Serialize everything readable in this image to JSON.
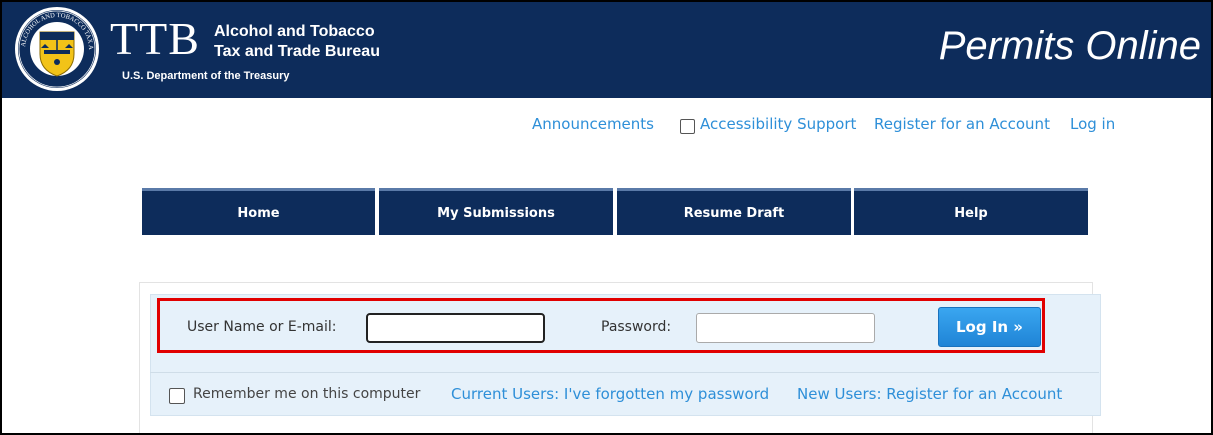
{
  "header": {
    "logo_text": "TTB",
    "agency_line1": "Alcohol and Tobacco",
    "agency_line2": "Tax and Trade Bureau",
    "department": "U.S. Department of the Treasury",
    "app_title": "Permits Online",
    "seal_text": "ALCOHOL AND TOBACCO TAX AND TRADE BUREAU"
  },
  "toplinks": {
    "announcements": "Announcements",
    "accessibility": "Accessibility Support",
    "register": "Register for an Account",
    "login": "Log in"
  },
  "nav": [
    "Home",
    "My Submissions",
    "Resume Draft",
    "Help"
  ],
  "login": {
    "username_label": "User Name or E-mail:",
    "username_value": "",
    "password_label": "Password:",
    "password_value": "",
    "button_label": "Log In »",
    "remember_label": "Remember me on this computer",
    "forgot_link": "Current Users: I've forgotten my password",
    "register_link": "New Users: Register for an Account"
  },
  "colors": {
    "header_bg": "#0d2c5b",
    "link": "#2e8fd8",
    "button": "#2a95e3",
    "highlight": "#e10000"
  }
}
